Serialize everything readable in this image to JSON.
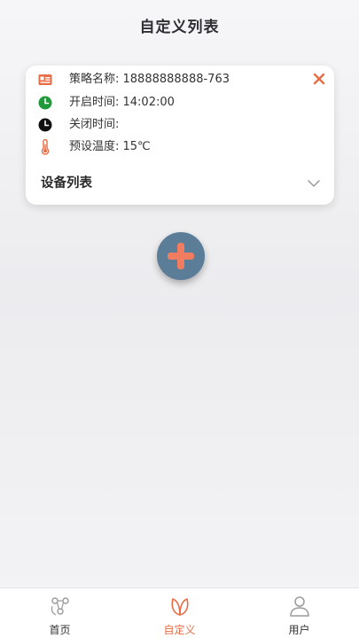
{
  "header": {
    "title": "自定义列表"
  },
  "card": {
    "rows": [
      {
        "icon": "id-card-icon",
        "text": "策略名称: 18888888888-763"
      },
      {
        "icon": "clock-green-icon",
        "text": "开启时间: 14:02:00"
      },
      {
        "icon": "clock-black-icon",
        "text": "关闭时间:"
      },
      {
        "icon": "thermometer-icon",
        "text": "预设温度: 15℃"
      }
    ],
    "close_icon": "close-icon",
    "device_list_label": "设备列表",
    "expand_icon": "chevron-down-icon"
  },
  "add_button": {
    "icon": "plus-icon"
  },
  "tabs": [
    {
      "label": "首页",
      "icon": "home-nodes-icon",
      "active": false
    },
    {
      "label": "自定义",
      "icon": "leaf-icon",
      "active": true
    },
    {
      "label": "用户",
      "icon": "user-icon",
      "active": false
    }
  ],
  "colors": {
    "accent": "#e86c45",
    "button_bg": "#5b7d98",
    "clock_green": "#1f9a3a"
  }
}
